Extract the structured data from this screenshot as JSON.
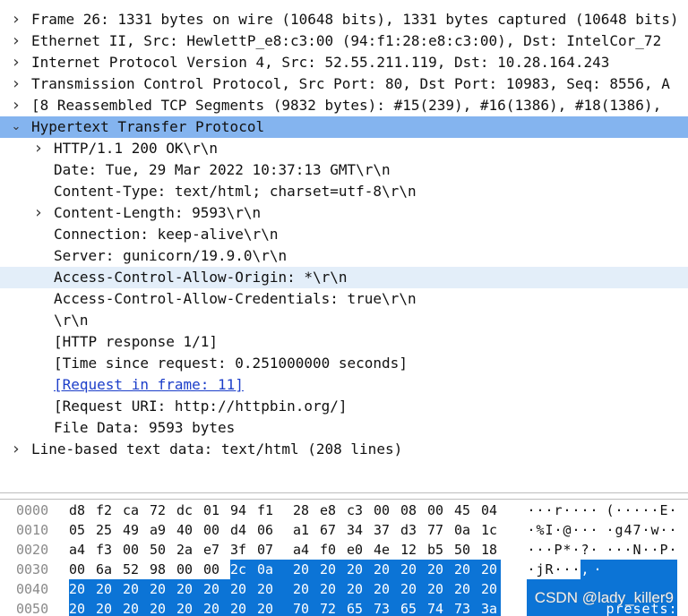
{
  "details": [
    {
      "text": "Frame 26: 1331 bytes on wire (10648 bits), 1331 bytes captured (10648 bits)",
      "level": 0,
      "arrow": "right"
    },
    {
      "text": "Ethernet II, Src: HewlettP_e8:c3:00 (94:f1:28:e8:c3:00), Dst: IntelCor_72",
      "level": 0,
      "arrow": "right"
    },
    {
      "text": "Internet Protocol Version 4, Src: 52.55.211.119, Dst: 10.28.164.243",
      "level": 0,
      "arrow": "right"
    },
    {
      "text": "Transmission Control Protocol, Src Port: 80, Dst Port: 10983, Seq: 8556, A",
      "level": 0,
      "arrow": "right"
    },
    {
      "text": "[8 Reassembled TCP Segments (9832 bytes): #15(239), #16(1386), #18(1386),",
      "level": 0,
      "arrow": "right"
    },
    {
      "text": "Hypertext Transfer Protocol",
      "level": 0,
      "arrow": "down",
      "state": "selected"
    },
    {
      "text": "HTTP/1.1 200 OK\\r\\n",
      "level": 1,
      "arrow": "right"
    },
    {
      "text": "Date: Tue, 29 Mar 2022 10:37:13 GMT\\r\\n",
      "level": 1,
      "arrow": ""
    },
    {
      "text": "Content-Type: text/html; charset=utf-8\\r\\n",
      "level": 1,
      "arrow": ""
    },
    {
      "text": "Content-Length: 9593\\r\\n",
      "level": 1,
      "arrow": "right"
    },
    {
      "text": "Connection: keep-alive\\r\\n",
      "level": 1,
      "arrow": ""
    },
    {
      "text": "Server: gunicorn/19.9.0\\r\\n",
      "level": 1,
      "arrow": ""
    },
    {
      "text": "Access-Control-Allow-Origin: *\\r\\n",
      "level": 1,
      "arrow": "",
      "state": "hover"
    },
    {
      "text": "Access-Control-Allow-Credentials: true\\r\\n",
      "level": 1,
      "arrow": ""
    },
    {
      "text": "\\r\\n",
      "level": 1,
      "arrow": ""
    },
    {
      "text": "[HTTP response 1/1]",
      "level": 1,
      "arrow": ""
    },
    {
      "text": "[Time since request: 0.251000000 seconds]",
      "level": 1,
      "arrow": ""
    },
    {
      "text": "[Request in frame: 11]",
      "level": 1,
      "arrow": "",
      "link": true
    },
    {
      "text": "[Request URI: http://httpbin.org/]",
      "level": 1,
      "arrow": ""
    },
    {
      "text": "File Data: 9593 bytes",
      "level": 1,
      "arrow": ""
    },
    {
      "text": "Line-based text data: text/html (208 lines)",
      "level": 0,
      "arrow": "right"
    }
  ],
  "hex_rows": [
    {
      "offset": "0000",
      "bytes": [
        "d8",
        "f2",
        "ca",
        "72",
        "dc",
        "01",
        "94",
        "f1",
        "28",
        "e8",
        "c3",
        "00",
        "08",
        "00",
        "45",
        "04"
      ],
      "ascii": [
        "·",
        "·",
        "·",
        "r",
        "·",
        "·",
        "·",
        "·",
        "(",
        "·",
        "·",
        "·",
        "·",
        "·",
        "E",
        "·"
      ],
      "hl_from": -1
    },
    {
      "offset": "0010",
      "bytes": [
        "05",
        "25",
        "49",
        "a9",
        "40",
        "00",
        "d4",
        "06",
        "a1",
        "67",
        "34",
        "37",
        "d3",
        "77",
        "0a",
        "1c"
      ],
      "ascii": [
        "·",
        "%",
        "I",
        "·",
        "@",
        "·",
        "·",
        "·",
        "·",
        "g",
        "4",
        "7",
        "·",
        "w",
        "·",
        "·"
      ],
      "hl_from": -1
    },
    {
      "offset": "0020",
      "bytes": [
        "a4",
        "f3",
        "00",
        "50",
        "2a",
        "e7",
        "3f",
        "07",
        "a4",
        "f0",
        "e0",
        "4e",
        "12",
        "b5",
        "50",
        "18"
      ],
      "ascii": [
        "·",
        "·",
        "·",
        "P",
        "*",
        "·",
        "?",
        "·",
        "·",
        "·",
        "·",
        "N",
        "·",
        "·",
        "P",
        "·"
      ],
      "hl_from": -1
    },
    {
      "offset": "0030",
      "bytes": [
        "00",
        "6a",
        "52",
        "98",
        "00",
        "00",
        "2c",
        "0a",
        "20",
        "20",
        "20",
        "20",
        "20",
        "20",
        "20",
        "20"
      ],
      "ascii": [
        "·",
        "j",
        "R",
        "·",
        "·",
        "·",
        ",",
        "·",
        " ",
        " ",
        " ",
        " ",
        " ",
        " ",
        " ",
        " "
      ],
      "hl_from": 6
    },
    {
      "offset": "0040",
      "bytes": [
        "20",
        "20",
        "20",
        "20",
        "20",
        "20",
        "20",
        "20",
        "20",
        "20",
        "20",
        "20",
        "20",
        "20",
        "20",
        "20"
      ],
      "ascii": [
        " ",
        " ",
        " ",
        " ",
        " ",
        " ",
        " ",
        " ",
        " ",
        " ",
        " ",
        " ",
        " ",
        " ",
        " ",
        " "
      ],
      "hl_from": 0
    },
    {
      "offset": "0050",
      "bytes": [
        "20",
        "20",
        "20",
        "20",
        "20",
        "20",
        "20",
        "20",
        "70",
        "72",
        "65",
        "73",
        "65",
        "74",
        "73",
        "3a"
      ],
      "ascii": [
        " ",
        " ",
        " ",
        " ",
        " ",
        " ",
        " ",
        " ",
        "p",
        "r",
        "e",
        "s",
        "e",
        "t",
        "s",
        ":"
      ],
      "hl_from": 0
    }
  ],
  "watermark": "CSDN @lady_killer9",
  "colors": {
    "selection": "#84b4ef",
    "hover": "#e3eef9",
    "hex_highlight": "#0c74d6",
    "link": "#1c3ec9"
  }
}
